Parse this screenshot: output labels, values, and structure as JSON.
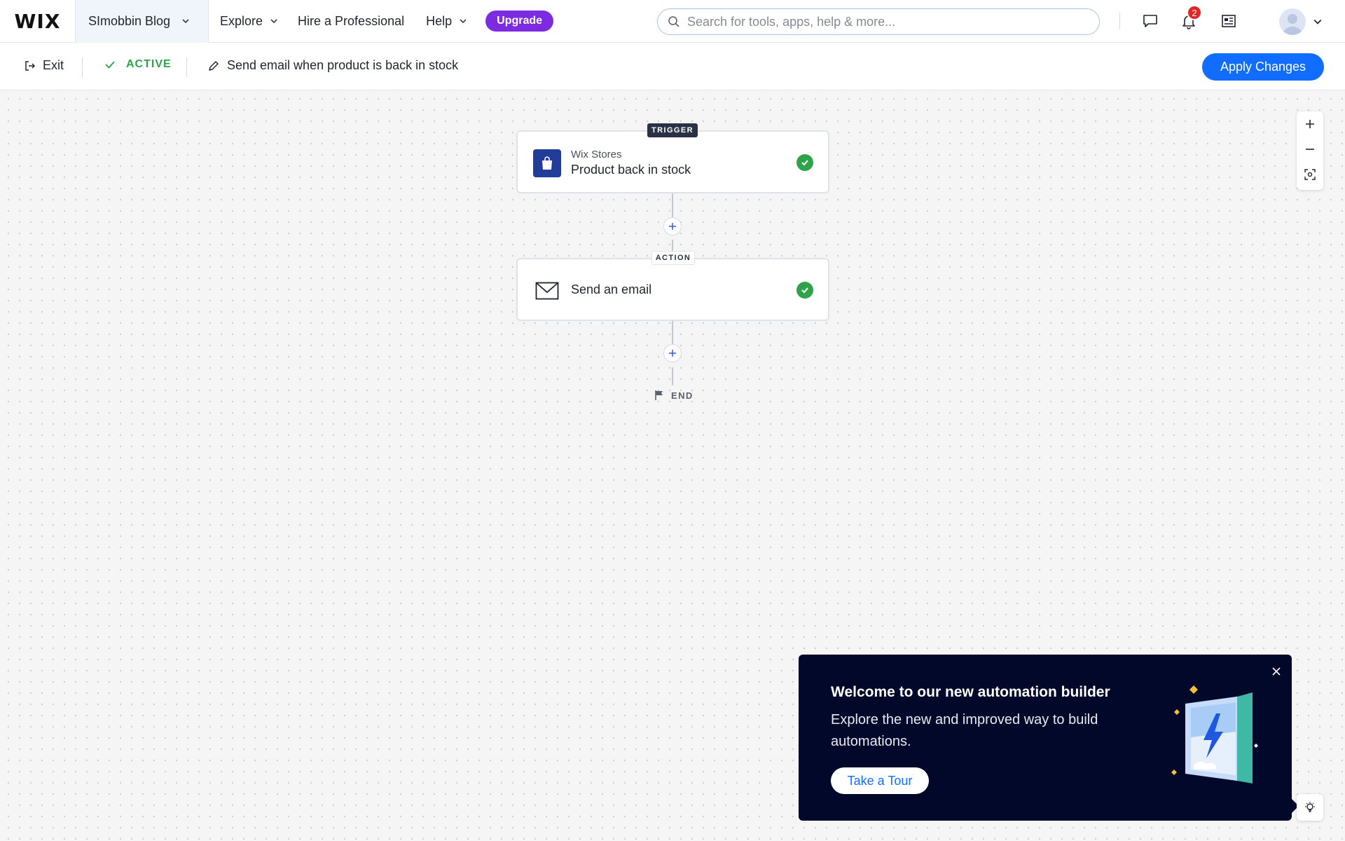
{
  "topnav": {
    "logo": "WIX",
    "site_name": "SImobbin Blog",
    "explore": "Explore",
    "hire": "Hire a Professional",
    "help": "Help",
    "upgrade": "Upgrade",
    "search_placeholder": "Search for tools, apps, help & more...",
    "notification_count": "2"
  },
  "toolbar": {
    "exit": "Exit",
    "status": "ACTIVE",
    "automation_name": "Send email when product is back in stock",
    "apply": "Apply Changes"
  },
  "flow": {
    "trigger_tag": "TRIGGER",
    "trigger_app": "Wix Stores",
    "trigger_title": "Product back in stock",
    "action_tag": "ACTION",
    "action_title": "Send an email",
    "end_label": "END"
  },
  "popup": {
    "title": "Welcome to our new automation builder",
    "body": "Explore the new and improved way to build automations.",
    "button": "Take a Tour"
  },
  "colors": {
    "primary": "#116dff",
    "upgrade": "#7d2be0",
    "success": "#2fa34c",
    "popup_bg": "#01082a",
    "badge": "#e02727"
  },
  "icons": [
    "search-icon",
    "chat-icon",
    "bell-icon",
    "news-icon",
    "avatar-icon",
    "exit-icon",
    "check-icon",
    "pencil-icon",
    "shopping-bag-icon",
    "envelope-icon",
    "flag-icon",
    "plus-icon",
    "minus-icon",
    "fit-screen-icon",
    "close-icon",
    "lightbulb-icon"
  ]
}
